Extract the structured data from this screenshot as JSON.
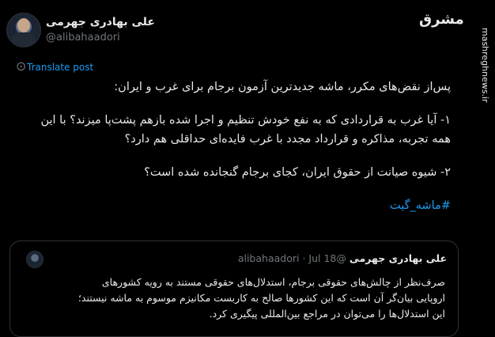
{
  "author": {
    "name": "علی بهادری جهرمی",
    "handle": "@alibahaadori"
  },
  "branding": {
    "logo_text": "مشرق",
    "site": "mashreghnews.ir"
  },
  "actions": {
    "translate": "Translate post",
    "more_icon": "more-dots-icon"
  },
  "tweet": {
    "line1": "پس‌از نقض‌های مکرر، ماشه جدیدترین آزمون برجام برای غرب و ایران:",
    "line2": "۱- آیا غرب به قراردادی که به نفع خودش تنظیم و اجرا شده بازهم پشت‌پا میزند؟ با این",
    "line3": "همه تجربه، مذاکره و قرارداد مجدد با غرب فایده‌ای حداقلی هم دارد؟",
    "line4": "۲- شیوه صیانت از حقوق ایران، کجای برجام گنجانده شده است؟",
    "hashtag": "#ماشه_گیت"
  },
  "quote": {
    "name": "علی بهادری جهرمی",
    "handle": "@alibahaadori",
    "sep": "·",
    "date": "Jul 18",
    "line1": "صرف‌نظر از چالش‌های حقوقی برجام، استدلال‌های حقوقی مستند به رویه کشورهای",
    "line2": "اروپایی بیان‌گر آن است که این کشورها صالح به کاربست مکانیزم موسوم به ماشه نیستند؛",
    "line3": "این استدلال‌ها را می‌توان در مراجع بین‌المللی پیگیری کرد."
  }
}
